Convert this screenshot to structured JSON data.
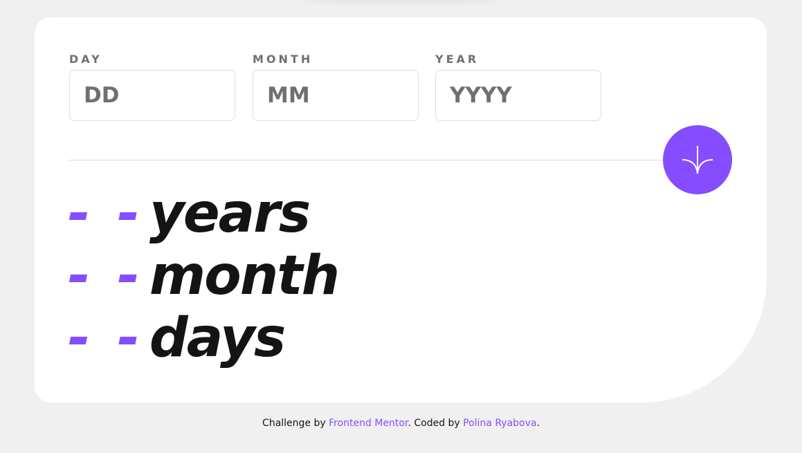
{
  "form": {
    "day": {
      "label": "DAY",
      "placeholder": "DD"
    },
    "month": {
      "label": "MONTH",
      "placeholder": "MM"
    },
    "year": {
      "label": "YEAR",
      "placeholder": "YYYY"
    }
  },
  "submit": {
    "icon": "arrow-down-icon"
  },
  "results": [
    {
      "value": "- -",
      "unit": "years"
    },
    {
      "value": "- -",
      "unit": "month"
    },
    {
      "value": "- -",
      "unit": "days"
    }
  ],
  "footer": {
    "prefix": "Challenge by ",
    "challenge_link": "Frontend Mentor",
    "middle": ". Coded by ",
    "author_link": "Polina Ryabova",
    "suffix": "."
  },
  "colors": {
    "accent": "#854dff",
    "text": "#141414",
    "label": "#716f6f",
    "background": "#f0f0f0"
  }
}
